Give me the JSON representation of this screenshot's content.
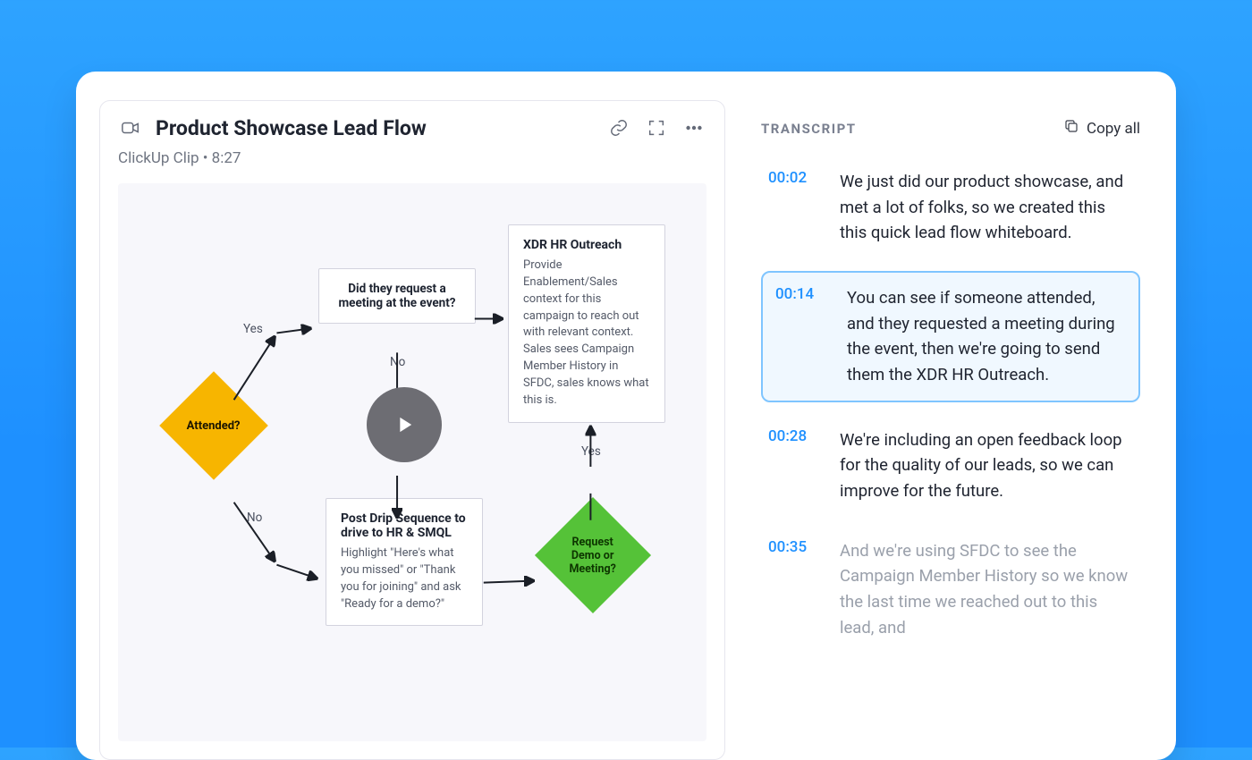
{
  "header": {
    "title": "Product Showcase Lead Flow",
    "subtitle": "ClickUp Clip • 8:27"
  },
  "whiteboard": {
    "attended": "Attended?",
    "yes": "Yes",
    "no": "No",
    "meeting_q": "Did they request a meeting at the event?",
    "outreach_title": "XDR HR Outreach",
    "outreach_body": "Provide Enablement/Sales context for this campaign to reach out with relevant context. Sales sees Campaign Member History in SFDC, sales knows what this is.",
    "drip_title": "Post Drip Sequence to drive to HR & SMQL",
    "drip_body": "Highlight \"Here's what you missed\" or \"Thank you for joining\" and ask \"Ready for a demo?\"",
    "demo_q": "Request Demo or Meeting?",
    "no2": "No",
    "yes2": "Yes"
  },
  "transcript": {
    "heading": "TRANSCRIPT",
    "copy_label": "Copy all",
    "entries": [
      {
        "ts": "00:02",
        "text": "We just did our product showcase, and met a lot of folks, so we created this this quick lead flow whiteboard."
      },
      {
        "ts": "00:14",
        "text": "You can see if someone attended, and they requested a meeting during the event, then we're going to send them the XDR HR Outreach."
      },
      {
        "ts": "00:28",
        "text": "We're including an open feedback loop for the quality of our leads, so we can improve for the future."
      },
      {
        "ts": "00:35",
        "text": "And we're using SFDC to see the Campaign Member History so we know the last time we reached out to this lead, and"
      }
    ],
    "selected_index": 1
  },
  "colors": {
    "attended_diamond": "#f7b500",
    "demo_diamond": "#55c238",
    "accent": "#1e90ff"
  }
}
